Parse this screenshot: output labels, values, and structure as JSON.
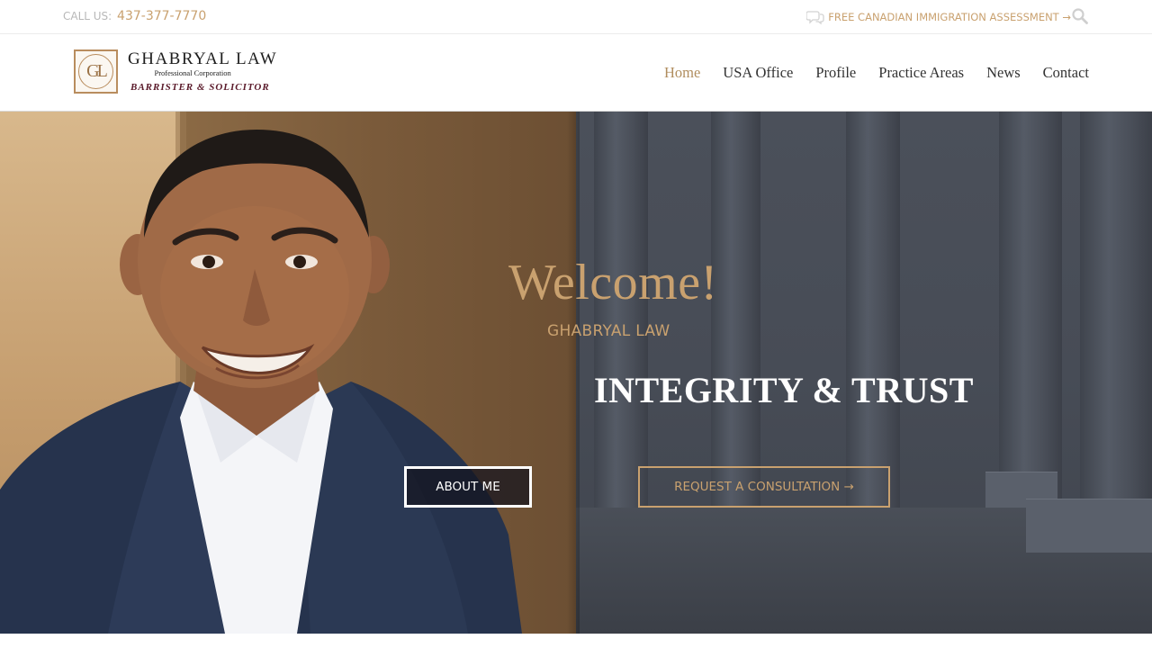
{
  "topbar": {
    "call_label": "CALL US:",
    "phone": "437-377-7770",
    "assessment": "FREE CANADIAN IMMIGRATION ASSESSMENT →",
    "chat_icon": "chat-bubbles-icon",
    "search_icon": "search-icon"
  },
  "header": {
    "logo": {
      "monogram": "GL",
      "name": "GHABRYAL LAW",
      "corporation": "Professional Corporation",
      "tagline": "BARRISTER & SOLICITOR"
    },
    "nav": [
      {
        "label": "Home",
        "active": true
      },
      {
        "label": "USA Office"
      },
      {
        "label": "Profile"
      },
      {
        "label": "Practice Areas"
      },
      {
        "label": "News"
      },
      {
        "label": "Contact"
      }
    ]
  },
  "hero": {
    "welcome": "Welcome!",
    "subtitle": "GHABRYAL LAW",
    "headline": "INTEGRITY & TRUST",
    "about_button": "ABOUT ME",
    "consult_button": "REQUEST A CONSULTATION →"
  },
  "colors": {
    "accent_gold": "#c9a16f",
    "nav_active": "#b08d5e",
    "logo_burgundy": "#5a1a2a",
    "hero_overlay": "#454a54"
  }
}
